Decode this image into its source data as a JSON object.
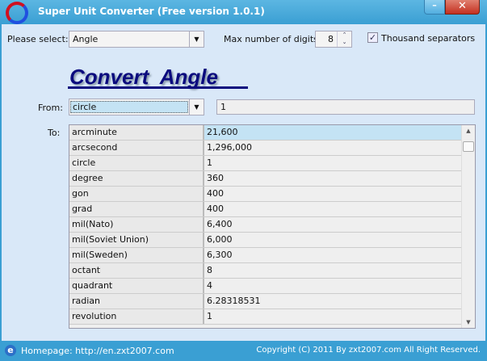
{
  "window": {
    "title": "Super Unit Converter (Free version 1.0.1)",
    "minimize": "–",
    "close": "✕"
  },
  "controls": {
    "select_label": "Please select:",
    "category": "Angle",
    "digits_label": "Max number of digits:",
    "digits": "8",
    "thousand_label": "Thousand separators",
    "thousand_checked": true,
    "check_glyph": "✓"
  },
  "heading": "Convert  Angle",
  "from": {
    "label": "From:",
    "unit": "circle",
    "value": "1"
  },
  "to": {
    "label": "To:",
    "rows": [
      {
        "unit": "arcminute",
        "value": "21,600"
      },
      {
        "unit": "arcsecond",
        "value": "1,296,000"
      },
      {
        "unit": "circle",
        "value": "1"
      },
      {
        "unit": "degree",
        "value": "360"
      },
      {
        "unit": "gon",
        "value": "400"
      },
      {
        "unit": "grad",
        "value": "400"
      },
      {
        "unit": "mil(Nato)",
        "value": "6,400"
      },
      {
        "unit": "mil(Soviet Union)",
        "value": "6,000"
      },
      {
        "unit": "mil(Sweden)",
        "value": "6,300"
      },
      {
        "unit": "octant",
        "value": "8"
      },
      {
        "unit": "quadrant",
        "value": "4"
      },
      {
        "unit": "radian",
        "value": "6.28318531"
      },
      {
        "unit": "revolution",
        "value": "1"
      }
    ]
  },
  "footer": {
    "homepage": "Homepage: http://en.zxt2007.com",
    "copyright": "Copyright (C) 2011 By zxt2007.com All Right Reserved."
  }
}
